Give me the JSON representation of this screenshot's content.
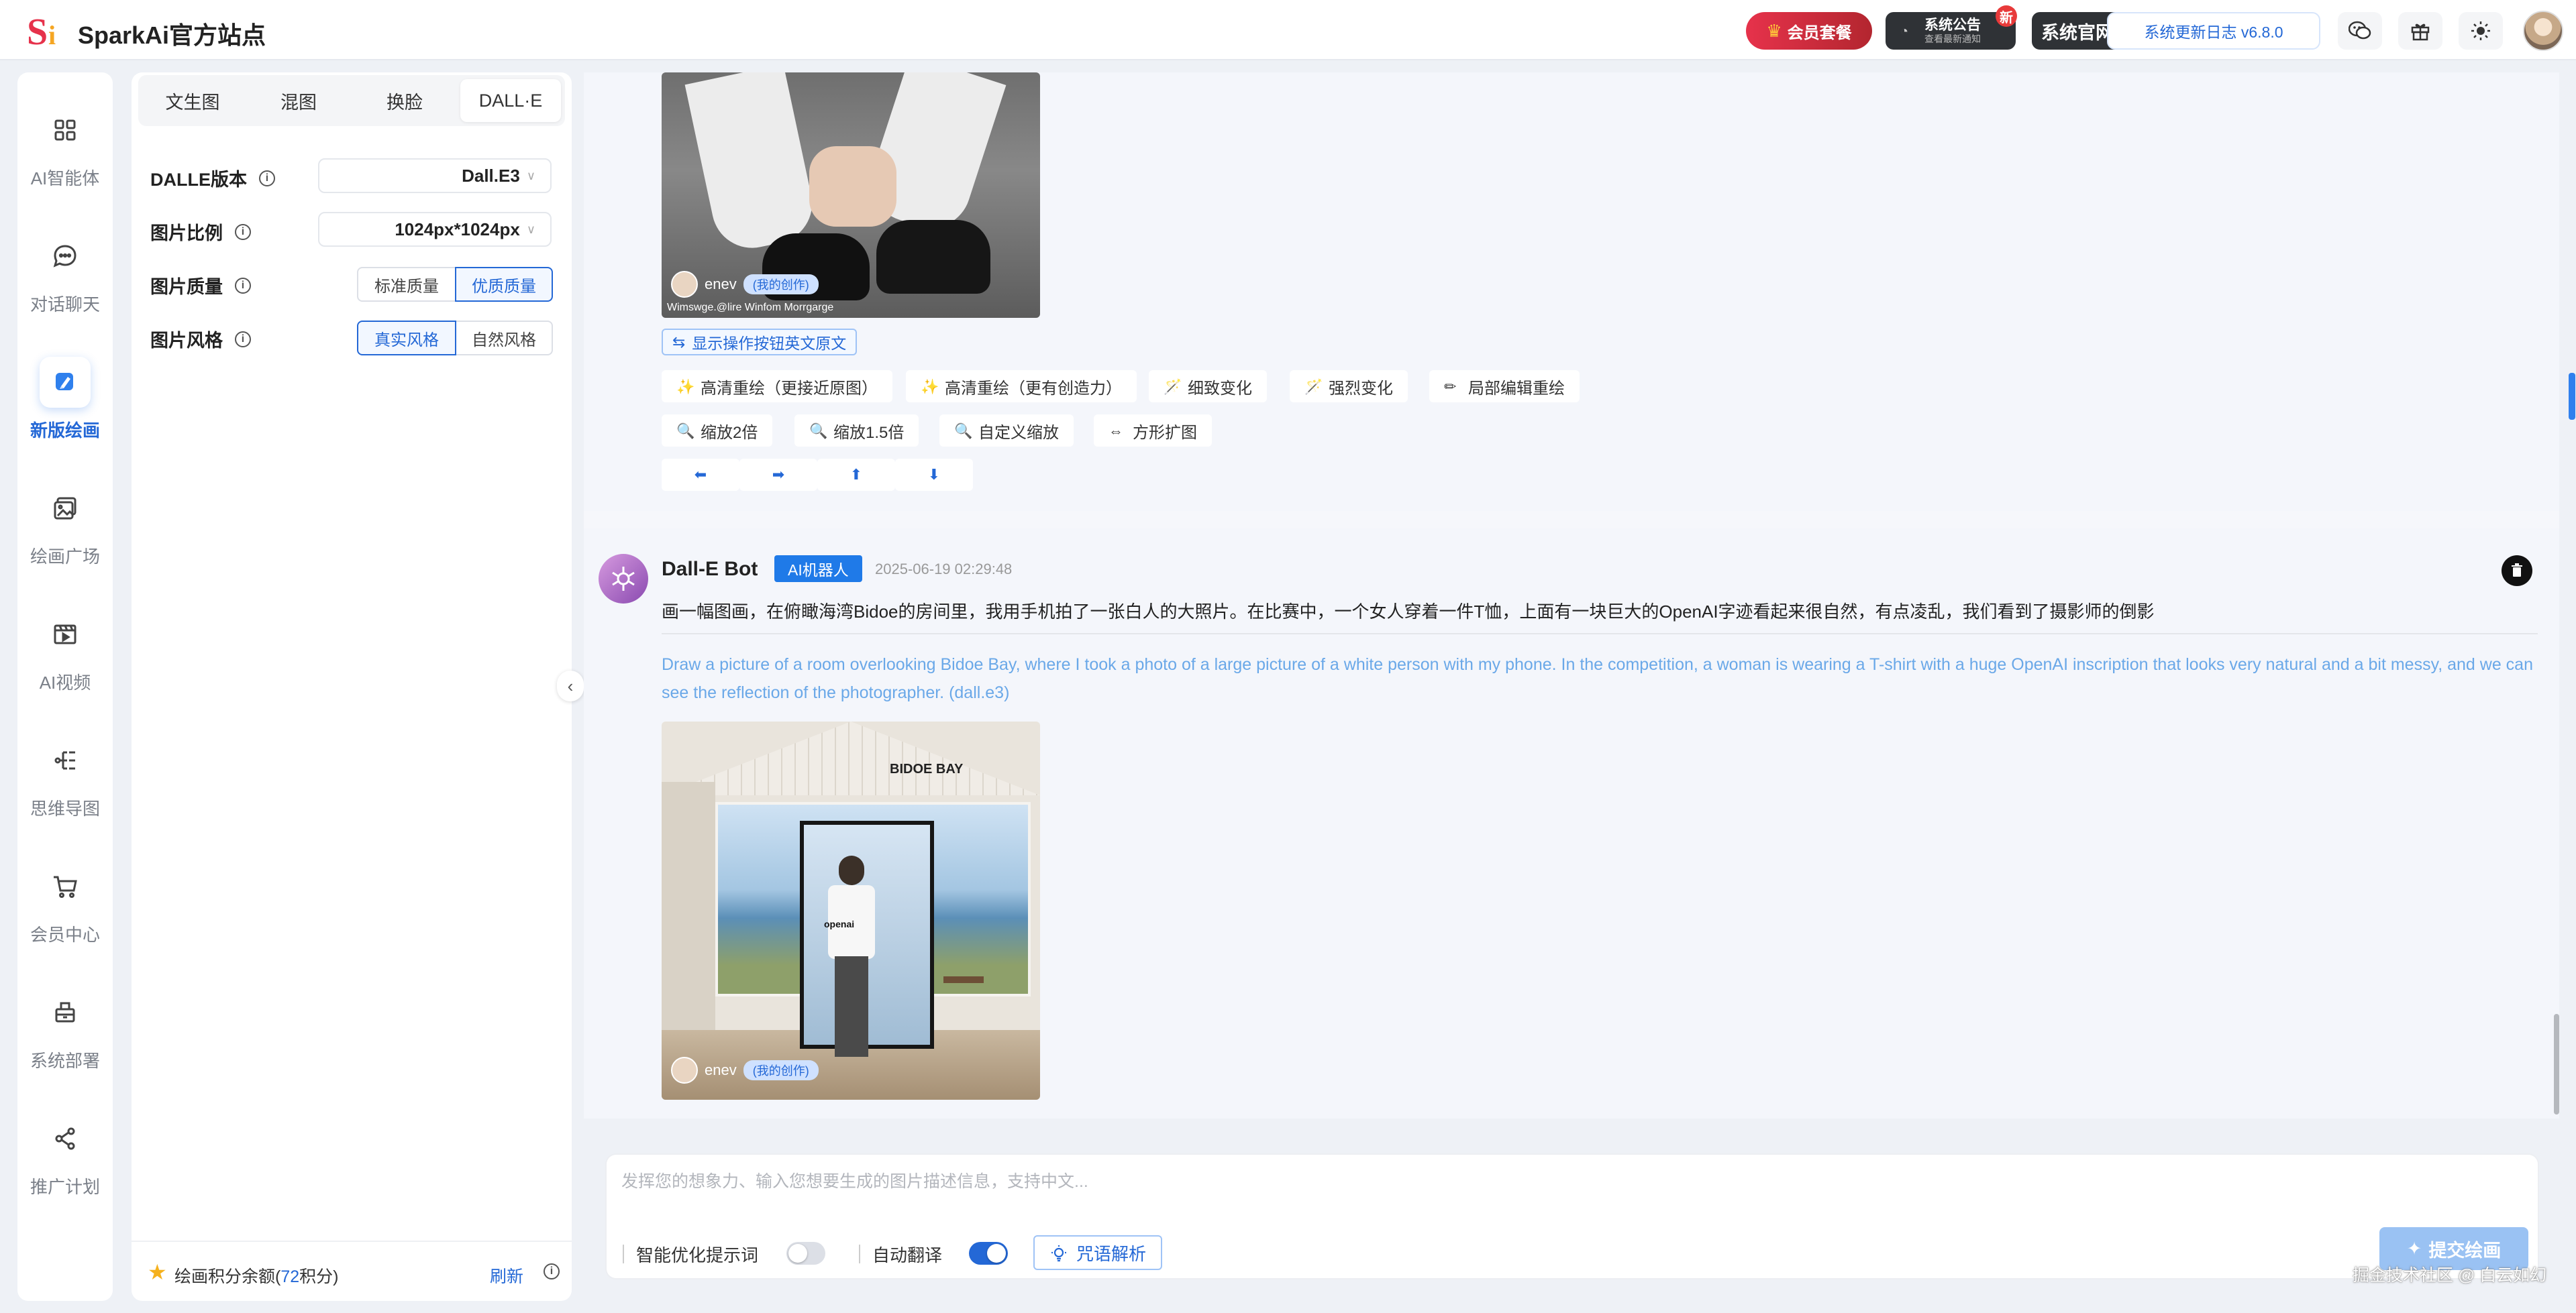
{
  "header": {
    "logo_text": "Si",
    "brand": "SparkAi官方站点",
    "vip_label": "会员套餐",
    "notice_title": "系统公告",
    "notice_sub": "查看最新通知",
    "notice_badge": "新",
    "site_label": "系统官网",
    "update_label": "系统更新日志 v6.8.0"
  },
  "nav": {
    "items": [
      {
        "label": "AI智能体",
        "icon": "grid-icon"
      },
      {
        "label": "对话聊天",
        "icon": "chat-bubble-icon"
      },
      {
        "label": "新版绘画",
        "icon": "paint-brush-icon",
        "active": true
      },
      {
        "label": "绘画广场",
        "icon": "image-gallery-icon"
      },
      {
        "label": "AI视频",
        "icon": "clapperboard-icon"
      },
      {
        "label": "思维导图",
        "icon": "mindmap-icon"
      },
      {
        "label": "会员中心",
        "icon": "cart-icon"
      },
      {
        "label": "系统部署",
        "icon": "deploy-box-icon"
      },
      {
        "label": "推广计划",
        "icon": "share-icon"
      }
    ]
  },
  "panel": {
    "tabs": [
      "文生图",
      "混图",
      "换脸",
      "DALL·E"
    ],
    "active_tab": "DALL·E",
    "version_label": "DALLE版本",
    "version_value": "Dall.E3",
    "ratio_label": "图片比例",
    "ratio_value": "1024px*1024px",
    "quality_label": "图片质量",
    "quality_options": [
      "标准质量",
      "优质质量"
    ],
    "quality_selected": "优质质量",
    "style_label": "图片风格",
    "style_options": [
      "真实风格",
      "自然风格"
    ],
    "style_selected": "真实风格",
    "credit_prefix": "绘画积分余额(",
    "credit_value": "72",
    "credit_suffix": "积分)",
    "refresh_label": "刷新"
  },
  "chat": {
    "msg1": {
      "author": "enev",
      "tag": "(我的创作)",
      "caption": "Wimswge.@lire Winfom Morrgarge",
      "show_original": "显示操作按钮英文原文",
      "actions_row1": [
        "高清重绘（更接近原图）",
        "高清重绘（更有创造力）",
        "细致变化",
        "强烈变化",
        "局部编辑重绘"
      ],
      "actions_row2": [
        "缩放2倍",
        "缩放1.5倍",
        "自定义缩放",
        "方形扩图"
      ],
      "arrows": [
        "⬅",
        "➡",
        "⬆",
        "⬇"
      ]
    },
    "msg2": {
      "bot_name": "Dall-E Bot",
      "badge": "AI机器人",
      "time": "2025-06-19 02:29:48",
      "prompt_cn": "画一幅图画，在俯瞰海湾Bidoe的房间里，我用手机拍了一张白人的大照片。在比赛中，一个女人穿着一件T恤，上面有一块巨大的OpenAI字迹看起来很自然，有点凌乱，我们看到了摄影师的倒影",
      "prompt_en": "Draw a picture of a room overlooking Bidoe Bay, where I took a photo of a large picture of a white person with my phone. In the competition, a woman is wearing a T-shirt with a huge OpenAI inscription that looks very natural and a bit messy, and we can see the reflection of the photographer.  (dall.e3)",
      "image_sign": "BIDOE BAY",
      "image_shirt": "openai",
      "author": "enev",
      "tag": "(我的创作)"
    }
  },
  "input": {
    "placeholder": "发挥您的想象力、输入您想要生成的图片描述信息，支持中文...",
    "opt_label": "智能优化提示词",
    "opt_on": false,
    "translate_label": "自动翻译",
    "translate_on": true,
    "parse_label": "咒语解析",
    "submit_label": "提交绘画"
  },
  "watermark": "掘金技术社区 @ 白云如幻",
  "colors": {
    "accent": "#2468d6",
    "vip": "#e6324b",
    "dark": "#2f3236"
  }
}
